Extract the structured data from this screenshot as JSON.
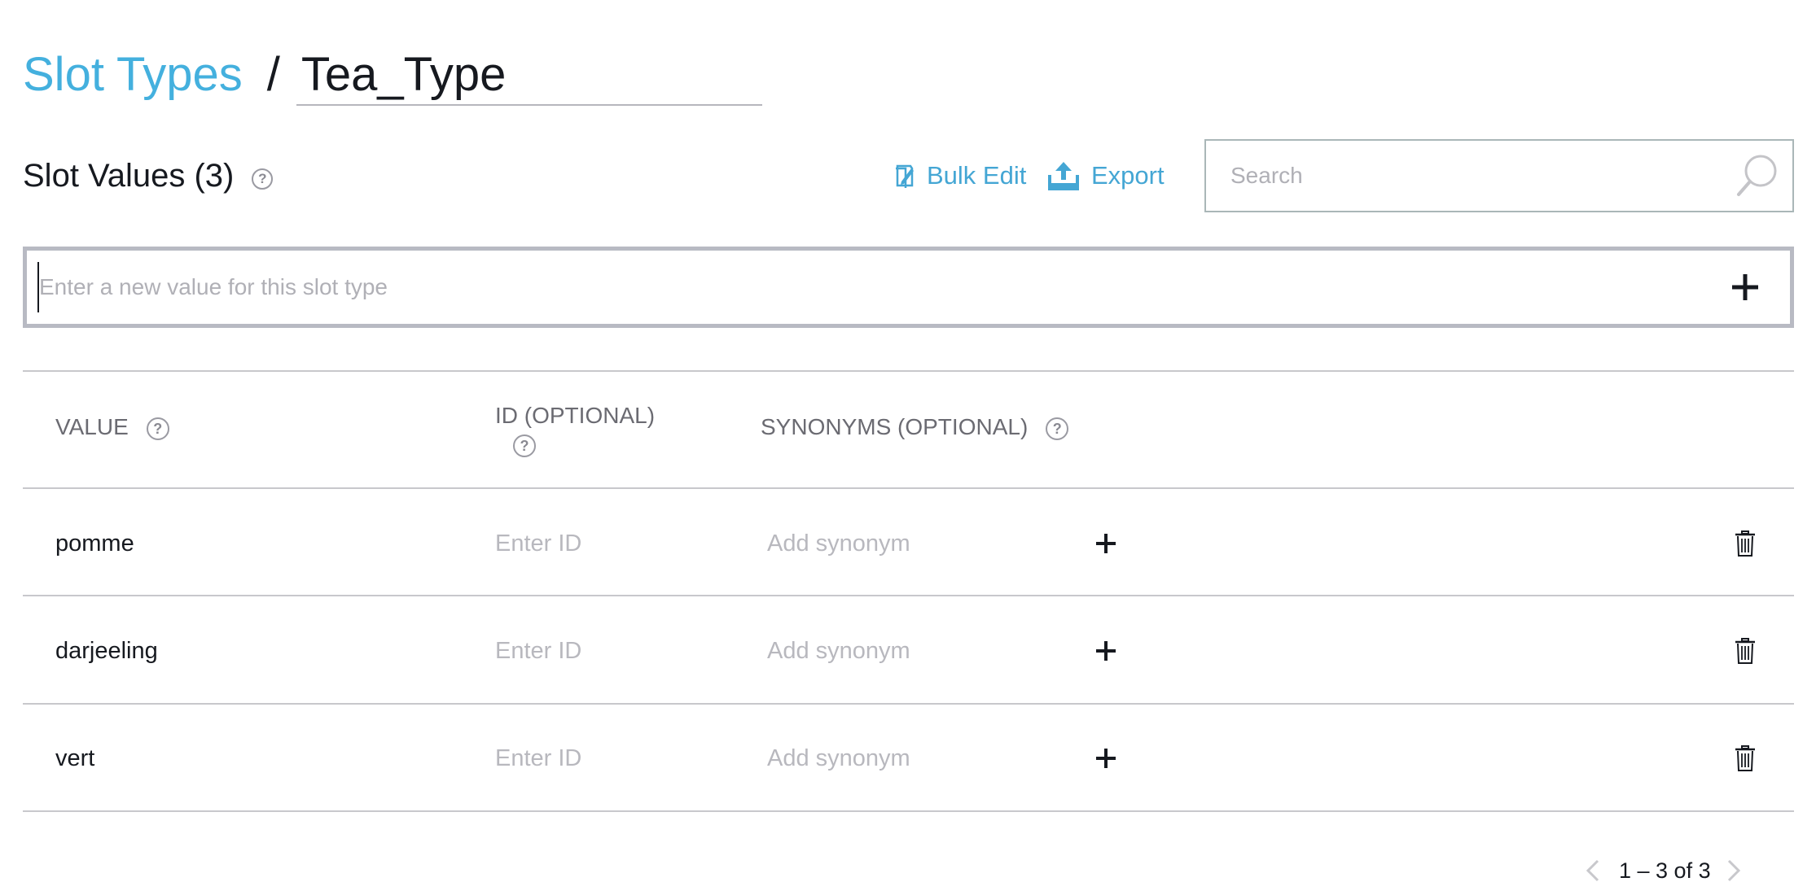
{
  "breadcrumb": {
    "parent_label": "Slot Types",
    "separator": "/",
    "current_value": "Tea_Type"
  },
  "section": {
    "title": "Slot Values (3)",
    "help_glyph": "?"
  },
  "actions": {
    "bulk_edit_label": "Bulk Edit",
    "export_label": "Export",
    "colors": {
      "link": "#44a6d4"
    }
  },
  "search": {
    "placeholder": "Search",
    "value": ""
  },
  "new_value": {
    "placeholder": "Enter a new value for this slot type",
    "value": ""
  },
  "table": {
    "columns": {
      "value": "VALUE",
      "id": "ID (OPTIONAL)",
      "synonyms": "SYNONYMS (OPTIONAL)"
    },
    "rows": [
      {
        "value": "pomme",
        "id_placeholder": "Enter ID",
        "synonym_placeholder": "Add synonym"
      },
      {
        "value": "darjeeling",
        "id_placeholder": "Enter ID",
        "synonym_placeholder": "Add synonym"
      },
      {
        "value": "vert",
        "id_placeholder": "Enter ID",
        "synonym_placeholder": "Add synonym"
      }
    ]
  },
  "pagination": {
    "label": "1 – 3 of 3"
  },
  "icons": {
    "bulk_edit": "bulk-edit-icon",
    "export": "export-upload-icon",
    "search": "magnifier-icon",
    "add": "plus-icon",
    "delete": "trash-icon",
    "prev": "chevron-left-icon",
    "next": "chevron-right-icon"
  },
  "colors": {
    "accent": "#44b0de",
    "text": "#16191f",
    "muted": "#6b6b72",
    "placeholder": "#b0b0b6",
    "border": "#c8c8cc"
  }
}
